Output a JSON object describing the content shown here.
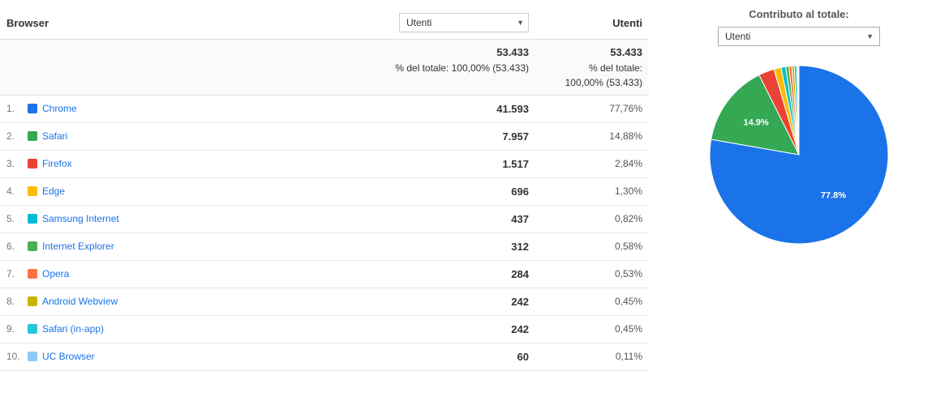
{
  "header": {
    "browser_col": "Browser",
    "dropdown_label": "Utenti",
    "utenti_col": "Utenti",
    "right_title": "Contributo al totale:",
    "right_dropdown": "Utenti"
  },
  "totals": {
    "metric_value": "53.433",
    "metric_sub": "% del totale: 100,00% (53.433)",
    "utenti_value": "53.433",
    "utenti_sub": "% del totale:\n100,00% (53.433)"
  },
  "rows": [
    {
      "num": "1.",
      "name": "Chrome",
      "color": "#1a73e8",
      "metric": "41.593",
      "utenti": "77,76%"
    },
    {
      "num": "2.",
      "name": "Safari",
      "color": "#34a853",
      "metric": "7.957",
      "utenti": "14,88%"
    },
    {
      "num": "3.",
      "name": "Firefox",
      "color": "#ea4335",
      "metric": "1.517",
      "utenti": "2,84%"
    },
    {
      "num": "4.",
      "name": "Edge",
      "color": "#fbbc04",
      "metric": "696",
      "utenti": "1,30%"
    },
    {
      "num": "5.",
      "name": "Samsung Internet",
      "color": "#00bcd4",
      "metric": "437",
      "utenti": "0,82%"
    },
    {
      "num": "6.",
      "name": "Internet Explorer",
      "color": "#4caf50",
      "metric": "312",
      "utenti": "0,58%"
    },
    {
      "num": "7.",
      "name": "Opera",
      "color": "#ff7043",
      "metric": "284",
      "utenti": "0,53%"
    },
    {
      "num": "8.",
      "name": "Android Webview",
      "color": "#c8b400",
      "metric": "242",
      "utenti": "0,45%"
    },
    {
      "num": "9.",
      "name": "Safari (in-app)",
      "color": "#26c6da",
      "metric": "242",
      "utenti": "0,45%"
    },
    {
      "num": "10.",
      "name": "UC Browser",
      "color": "#90caf9",
      "metric": "60",
      "utenti": "0,11%"
    }
  ],
  "chart": {
    "segments": [
      {
        "name": "Chrome",
        "value": 77.76,
        "color": "#1a73e8",
        "startAngle": 0
      },
      {
        "name": "Safari",
        "value": 14.88,
        "color": "#34a853",
        "startAngle": 279.936
      },
      {
        "name": "Firefox",
        "value": 2.84,
        "color": "#ea4335",
        "startAngle": 333.504
      },
      {
        "name": "Edge",
        "value": 1.3,
        "color": "#fbbc04",
        "startAngle": 343.728
      },
      {
        "name": "Samsung Internet",
        "value": 0.82,
        "color": "#00bcd4",
        "startAngle": 348.408
      },
      {
        "name": "Internet Explorer",
        "value": 0.58,
        "color": "#4caf50",
        "startAngle": 351.36
      },
      {
        "name": "Opera",
        "value": 0.53,
        "color": "#ff7043",
        "startAngle": 354.448
      },
      {
        "name": "Android Webview",
        "value": 0.45,
        "color": "#c8b400",
        "startAngle": 356.36
      },
      {
        "name": "Safari in-app",
        "value": 0.45,
        "color": "#26c6da",
        "startAngle": 357.98
      },
      {
        "name": "UC Browser",
        "value": 0.11,
        "color": "#90caf9",
        "startAngle": 359.6
      }
    ]
  }
}
